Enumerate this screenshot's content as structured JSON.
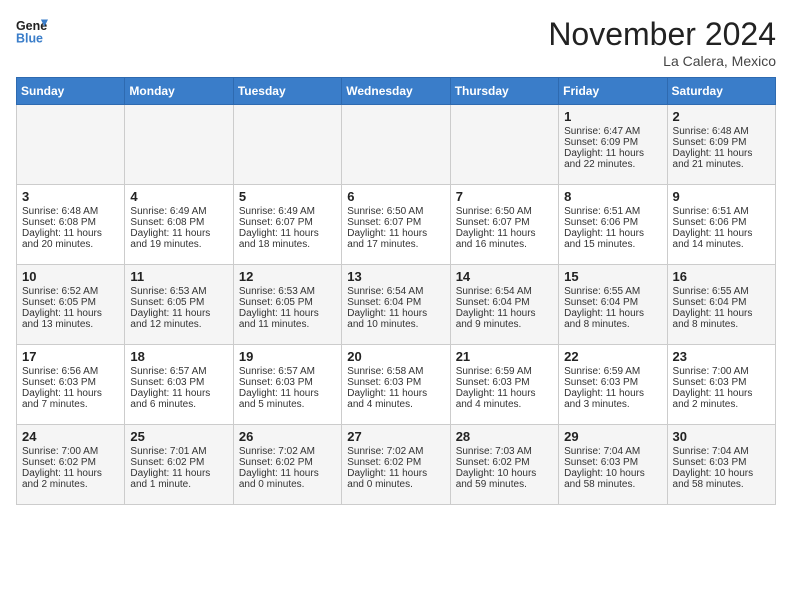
{
  "header": {
    "logo_line1": "General",
    "logo_line2": "Blue",
    "month": "November 2024",
    "location": "La Calera, Mexico"
  },
  "days_of_week": [
    "Sunday",
    "Monday",
    "Tuesday",
    "Wednesday",
    "Thursday",
    "Friday",
    "Saturday"
  ],
  "weeks": [
    [
      {
        "day": "",
        "info": ""
      },
      {
        "day": "",
        "info": ""
      },
      {
        "day": "",
        "info": ""
      },
      {
        "day": "",
        "info": ""
      },
      {
        "day": "",
        "info": ""
      },
      {
        "day": "1",
        "info": "Sunrise: 6:47 AM\nSunset: 6:09 PM\nDaylight: 11 hours and 22 minutes."
      },
      {
        "day": "2",
        "info": "Sunrise: 6:48 AM\nSunset: 6:09 PM\nDaylight: 11 hours and 21 minutes."
      }
    ],
    [
      {
        "day": "3",
        "info": "Sunrise: 6:48 AM\nSunset: 6:08 PM\nDaylight: 11 hours and 20 minutes."
      },
      {
        "day": "4",
        "info": "Sunrise: 6:49 AM\nSunset: 6:08 PM\nDaylight: 11 hours and 19 minutes."
      },
      {
        "day": "5",
        "info": "Sunrise: 6:49 AM\nSunset: 6:07 PM\nDaylight: 11 hours and 18 minutes."
      },
      {
        "day": "6",
        "info": "Sunrise: 6:50 AM\nSunset: 6:07 PM\nDaylight: 11 hours and 17 minutes."
      },
      {
        "day": "7",
        "info": "Sunrise: 6:50 AM\nSunset: 6:07 PM\nDaylight: 11 hours and 16 minutes."
      },
      {
        "day": "8",
        "info": "Sunrise: 6:51 AM\nSunset: 6:06 PM\nDaylight: 11 hours and 15 minutes."
      },
      {
        "day": "9",
        "info": "Sunrise: 6:51 AM\nSunset: 6:06 PM\nDaylight: 11 hours and 14 minutes."
      }
    ],
    [
      {
        "day": "10",
        "info": "Sunrise: 6:52 AM\nSunset: 6:05 PM\nDaylight: 11 hours and 13 minutes."
      },
      {
        "day": "11",
        "info": "Sunrise: 6:53 AM\nSunset: 6:05 PM\nDaylight: 11 hours and 12 minutes."
      },
      {
        "day": "12",
        "info": "Sunrise: 6:53 AM\nSunset: 6:05 PM\nDaylight: 11 hours and 11 minutes."
      },
      {
        "day": "13",
        "info": "Sunrise: 6:54 AM\nSunset: 6:04 PM\nDaylight: 11 hours and 10 minutes."
      },
      {
        "day": "14",
        "info": "Sunrise: 6:54 AM\nSunset: 6:04 PM\nDaylight: 11 hours and 9 minutes."
      },
      {
        "day": "15",
        "info": "Sunrise: 6:55 AM\nSunset: 6:04 PM\nDaylight: 11 hours and 8 minutes."
      },
      {
        "day": "16",
        "info": "Sunrise: 6:55 AM\nSunset: 6:04 PM\nDaylight: 11 hours and 8 minutes."
      }
    ],
    [
      {
        "day": "17",
        "info": "Sunrise: 6:56 AM\nSunset: 6:03 PM\nDaylight: 11 hours and 7 minutes."
      },
      {
        "day": "18",
        "info": "Sunrise: 6:57 AM\nSunset: 6:03 PM\nDaylight: 11 hours and 6 minutes."
      },
      {
        "day": "19",
        "info": "Sunrise: 6:57 AM\nSunset: 6:03 PM\nDaylight: 11 hours and 5 minutes."
      },
      {
        "day": "20",
        "info": "Sunrise: 6:58 AM\nSunset: 6:03 PM\nDaylight: 11 hours and 4 minutes."
      },
      {
        "day": "21",
        "info": "Sunrise: 6:59 AM\nSunset: 6:03 PM\nDaylight: 11 hours and 4 minutes."
      },
      {
        "day": "22",
        "info": "Sunrise: 6:59 AM\nSunset: 6:03 PM\nDaylight: 11 hours and 3 minutes."
      },
      {
        "day": "23",
        "info": "Sunrise: 7:00 AM\nSunset: 6:03 PM\nDaylight: 11 hours and 2 minutes."
      }
    ],
    [
      {
        "day": "24",
        "info": "Sunrise: 7:00 AM\nSunset: 6:02 PM\nDaylight: 11 hours and 2 minutes."
      },
      {
        "day": "25",
        "info": "Sunrise: 7:01 AM\nSunset: 6:02 PM\nDaylight: 11 hours and 1 minute."
      },
      {
        "day": "26",
        "info": "Sunrise: 7:02 AM\nSunset: 6:02 PM\nDaylight: 11 hours and 0 minutes."
      },
      {
        "day": "27",
        "info": "Sunrise: 7:02 AM\nSunset: 6:02 PM\nDaylight: 11 hours and 0 minutes."
      },
      {
        "day": "28",
        "info": "Sunrise: 7:03 AM\nSunset: 6:02 PM\nDaylight: 10 hours and 59 minutes."
      },
      {
        "day": "29",
        "info": "Sunrise: 7:04 AM\nSunset: 6:03 PM\nDaylight: 10 hours and 58 minutes."
      },
      {
        "day": "30",
        "info": "Sunrise: 7:04 AM\nSunset: 6:03 PM\nDaylight: 10 hours and 58 minutes."
      }
    ]
  ]
}
